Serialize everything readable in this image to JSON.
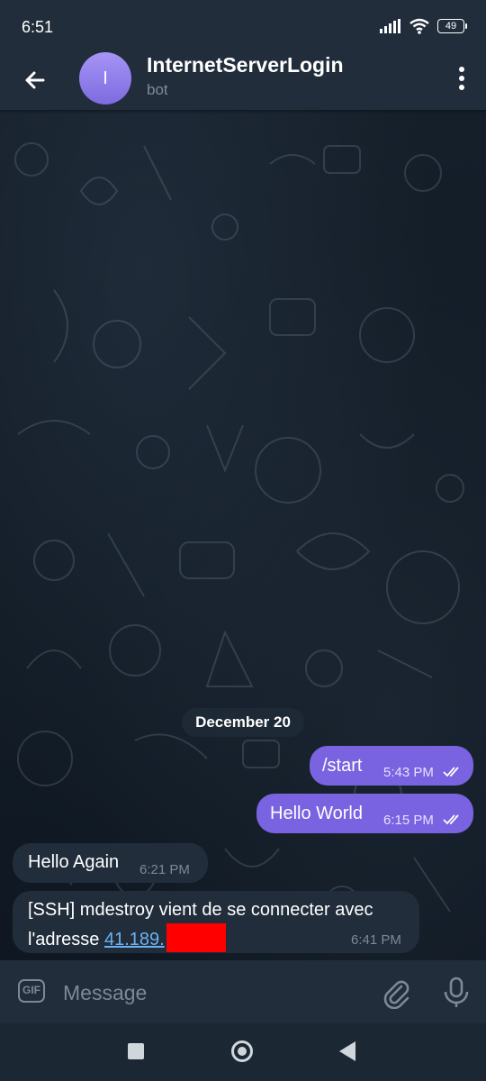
{
  "status_bar": {
    "time": "6:51",
    "battery": "49"
  },
  "header": {
    "avatar_letter": "I",
    "title": "InternetServerLogin",
    "subtitle": "bot"
  },
  "chat": {
    "date_separator": "December 20",
    "messages": [
      {
        "direction": "outgoing",
        "text": "/start",
        "time": "5:43 PM",
        "status": "read"
      },
      {
        "direction": "outgoing",
        "text": "Hello World",
        "time": "6:15 PM",
        "status": "read"
      },
      {
        "direction": "incoming",
        "text": "Hello Again",
        "time": "6:21 PM"
      },
      {
        "direction": "incoming",
        "line1": "[SSH] mdestroy vient de se connecter avec",
        "line2_prefix": "l'adresse ",
        "link_text": "41.189.",
        "time": "6:41 PM"
      }
    ]
  },
  "composer": {
    "gif_label": "GIF",
    "placeholder": "Message"
  },
  "colors": {
    "outgoing_bubble": "#7a63e0",
    "incoming_bubble": "#212d3b",
    "link": "#6ab2f2",
    "redaction": "#ff0000"
  },
  "icons": [
    "back-arrow-icon",
    "more-vertical-icon",
    "gif-icon",
    "paperclip-icon",
    "microphone-icon",
    "read-checkmarks-icon"
  ]
}
